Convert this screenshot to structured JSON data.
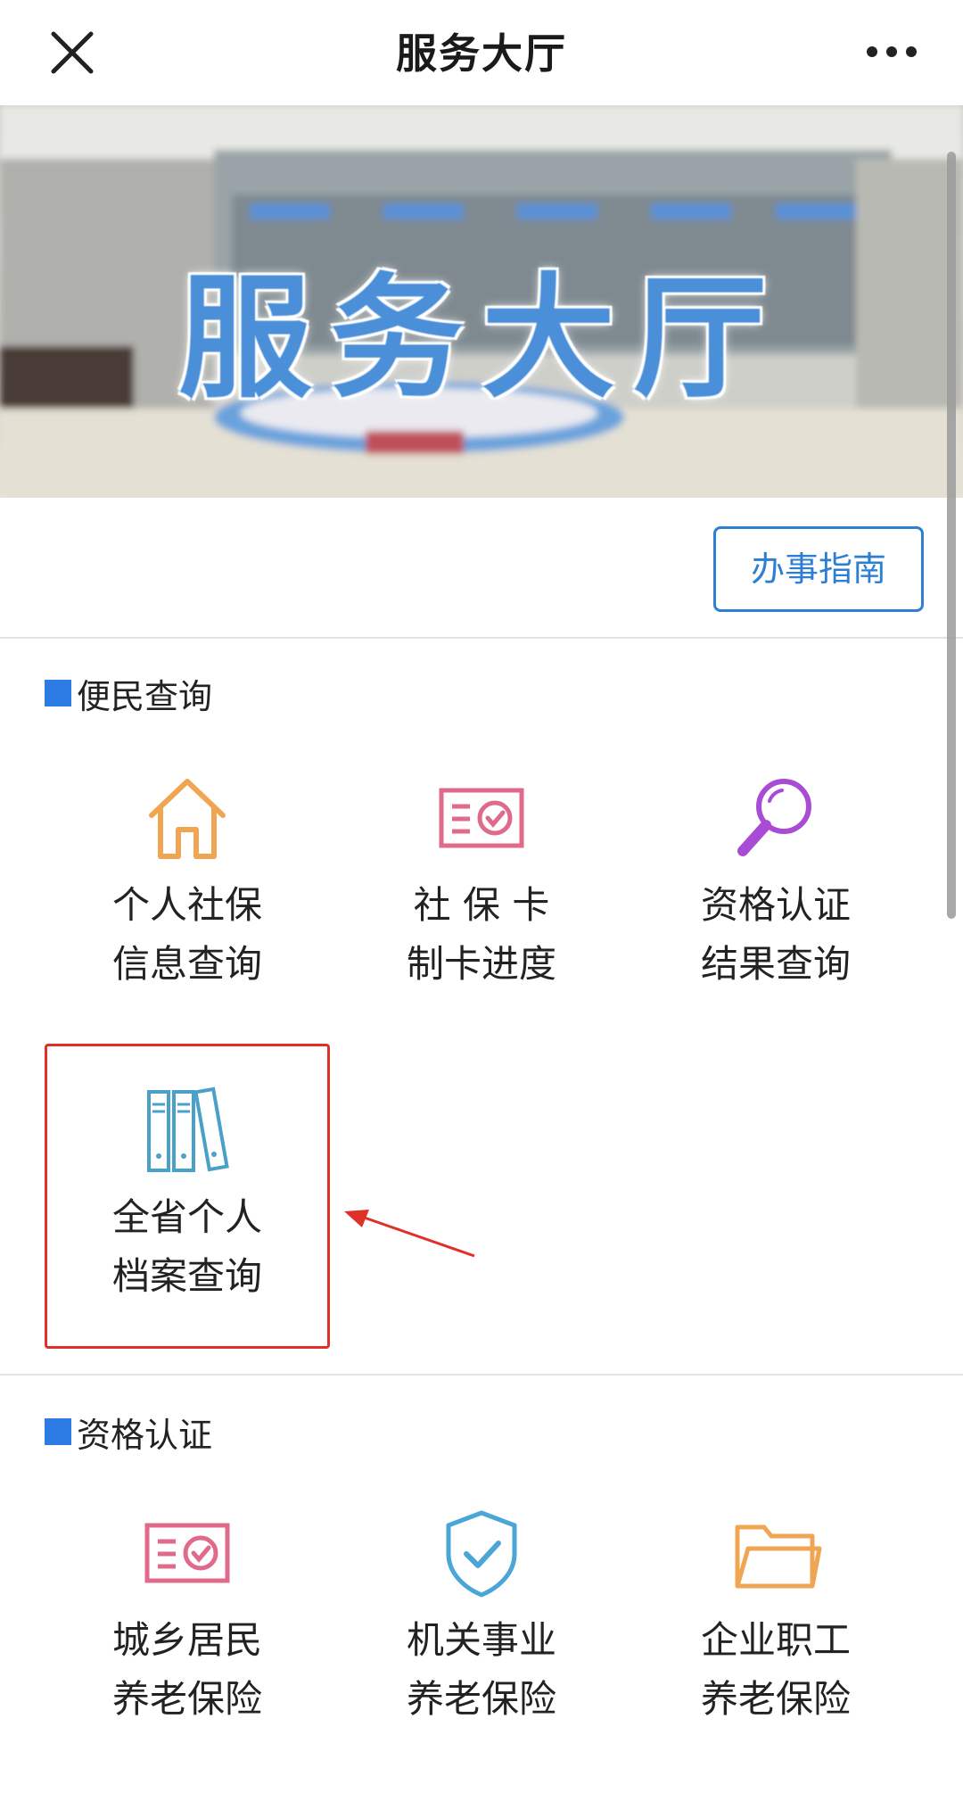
{
  "navbar": {
    "title": "服务大厅",
    "close_icon": "close-icon",
    "more_icon": "more-icon"
  },
  "banner": {
    "text": "服务大厅"
  },
  "guide": {
    "button_label": "办事指南"
  },
  "sections": [
    {
      "title": "便民查询",
      "items": [
        {
          "label": "个人社保\n信息查询",
          "icon": "house-icon",
          "color": "#f0a552"
        },
        {
          "label": "社 保 卡\n制卡进度",
          "icon": "certificate-icon",
          "color": "#e06a8a"
        },
        {
          "label": "资格认证\n结果查询",
          "icon": "magnifier-icon",
          "color": "#a84cd6"
        },
        {
          "label": "全省个人\n档案查询",
          "icon": "binders-icon",
          "color": "#4aa0c8"
        }
      ]
    },
    {
      "title": "资格认证",
      "items": [
        {
          "label": "城乡居民\n养老保险",
          "icon": "certificate-icon",
          "color": "#e06a8a"
        },
        {
          "label": "机关事业\n养老保险",
          "icon": "shield-check-icon",
          "color": "#4aa6d6"
        },
        {
          "label": "企业职工\n养老保险",
          "icon": "folder-icon",
          "color": "#f0a552"
        }
      ]
    }
  ],
  "colors": {
    "accent": "#2e7fd2",
    "section_marker": "#2d7be5",
    "highlight": "#e0302a"
  }
}
